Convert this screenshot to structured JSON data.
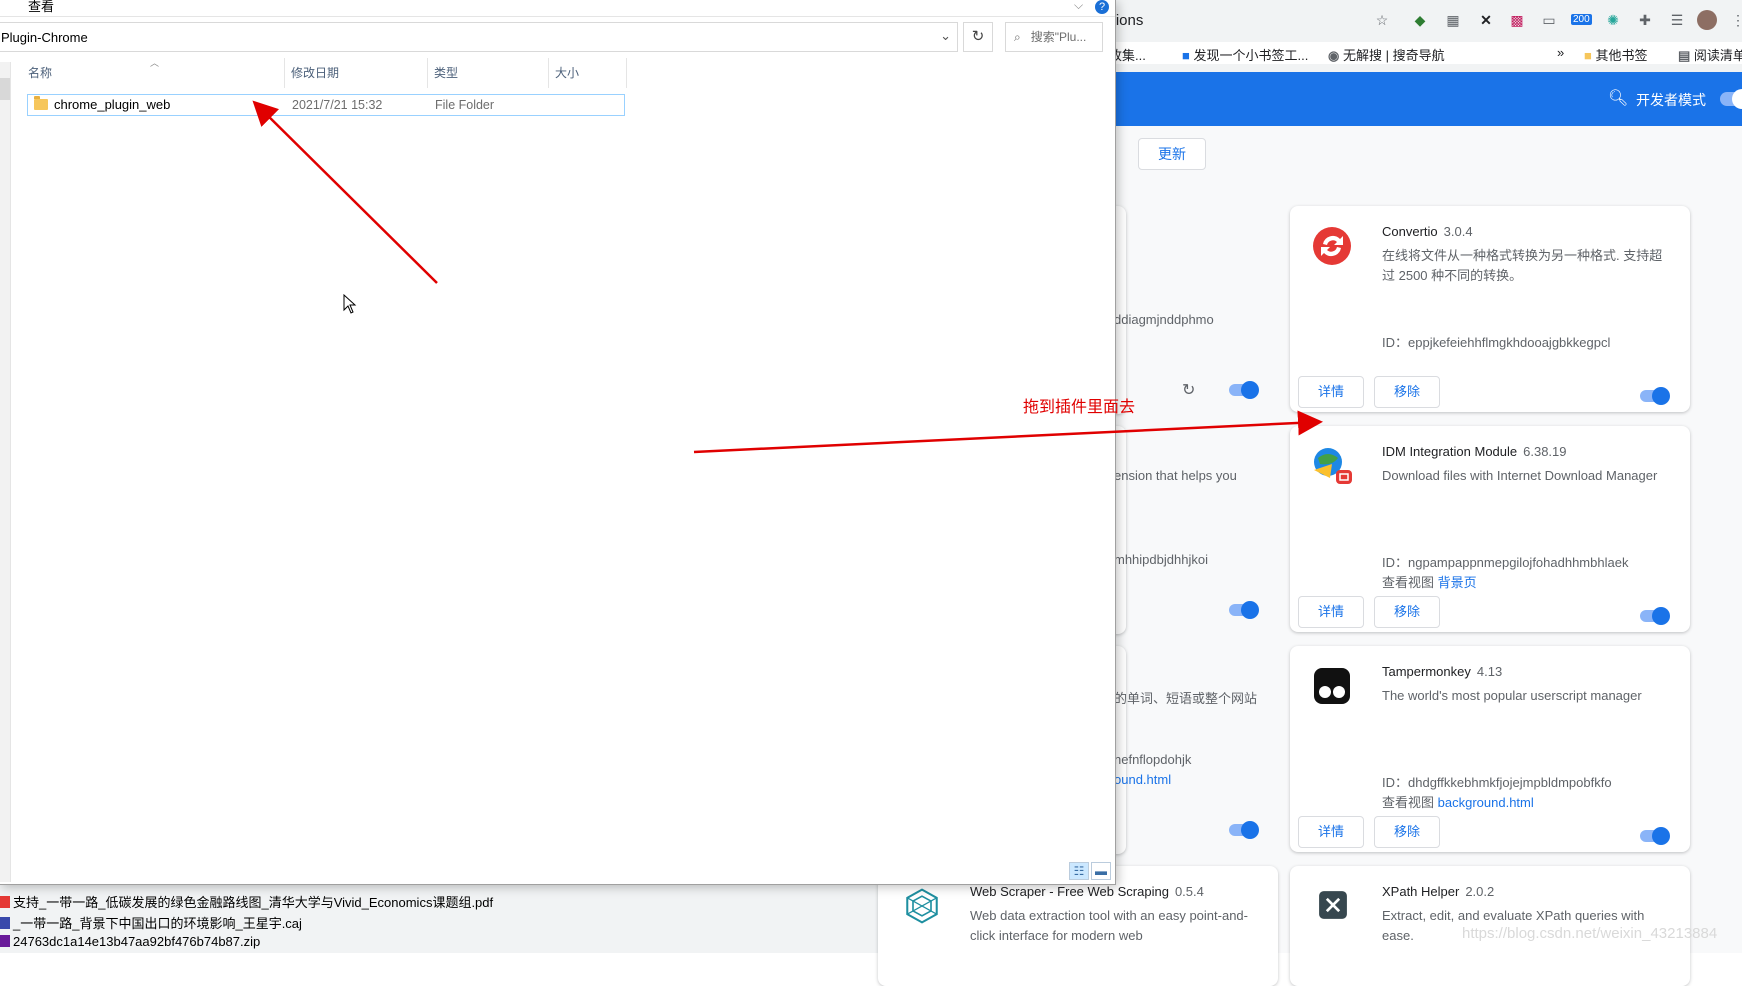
{
  "explorer": {
    "view_menu": "查看",
    "help": "?",
    "address_path": "Plugin-Chrome",
    "refresh": "↻",
    "search_placeholder": "搜索\"Plu...",
    "columns": {
      "name": "名称",
      "modified": "修改日期",
      "type": "类型",
      "size": "大小"
    },
    "rows": [
      {
        "name": "chrome_plugin_web",
        "modified": "2021/7/21 15:32",
        "type": "File Folder",
        "size": ""
      }
    ]
  },
  "desktop_files": [
    {
      "name": "支持_一带一路_低碳发展的绿色金融路线图_清华大学与Vivid_Economics课题组.pdf"
    },
    {
      "name": "_一带一路_背景下中国出口的环境影响_王星宇.caj"
    },
    {
      "name": "24763dc1a14e13b47aa92bf476b74b87.zip"
    }
  ],
  "chrome": {
    "omnibox_text": "nsions",
    "toolbar_badge": "200",
    "bookmarks": [
      {
        "label": "| 收集..."
      },
      {
        "label": "发现一个小书签工..."
      },
      {
        "label": "无解搜 | 搜奇导航"
      },
      {
        "label": "»"
      },
      {
        "label": "其他书签"
      },
      {
        "label": "阅读清单"
      }
    ],
    "developer_mode_label": "开发者模式",
    "update_button": "更新",
    "left_fragments": {
      "f1": "i",
      "f2": "ddiagmjnddphmo",
      "f3": "ension that helps you",
      "f4": "mhhipdbjdhhjkoi",
      "f5": "的单词、短语或整个网站",
      "f6": "nefnflopdohjk",
      "f7": "ound.html"
    },
    "cards": [
      {
        "name": "Convertio",
        "version": "3.0.4",
        "description": "在线将文件从一种格式转换为另一种格式. 支持超过 2500 种不同的转换。",
        "id": "ID：eppjkefeiehhflmgkhdooajgbkkegpcl",
        "view_label": "",
        "view_link": "",
        "details": "详情",
        "remove": "移除"
      },
      {
        "name": "IDM Integration Module",
        "version": "6.38.19",
        "description": "Download files with Internet Download Manager",
        "id": "ID：ngpampappnmepgilojfohadhhmbhlaek",
        "view_label": "查看视图",
        "view_link": "背景页",
        "details": "详情",
        "remove": "移除"
      },
      {
        "name": "Tampermonkey",
        "version": "4.13",
        "description": "The world's most popular userscript manager",
        "id": "ID：dhdgffkkebhmkfjojejmpbldmpobfkfo",
        "view_label": "查看视图",
        "view_link": "background.html",
        "details": "详情",
        "remove": "移除"
      },
      {
        "name": "XPath Helper",
        "version": "2.0.2",
        "description": "Extract, edit, and evaluate XPath queries with ease.",
        "id": "",
        "view_label": "",
        "view_link": "",
        "details": "",
        "remove": ""
      },
      {
        "name": "Web Scraper - Free Web Scraping",
        "version": "0.5.4",
        "description": "Web data extraction tool with an easy point-and-click interface for modern web",
        "id": "",
        "view_label": "",
        "view_link": "",
        "details": "",
        "remove": ""
      }
    ]
  },
  "annotation": {
    "label": "拖到插件里面去",
    "color": "#e00000"
  },
  "watermark": "https://blog.csdn.net/weixin_43213884",
  "colors": {
    "accent": "#1a73e8",
    "toggle_track": "#8ab4f8",
    "selection_border": "#99d1ff",
    "folder": "#f6c65b"
  }
}
